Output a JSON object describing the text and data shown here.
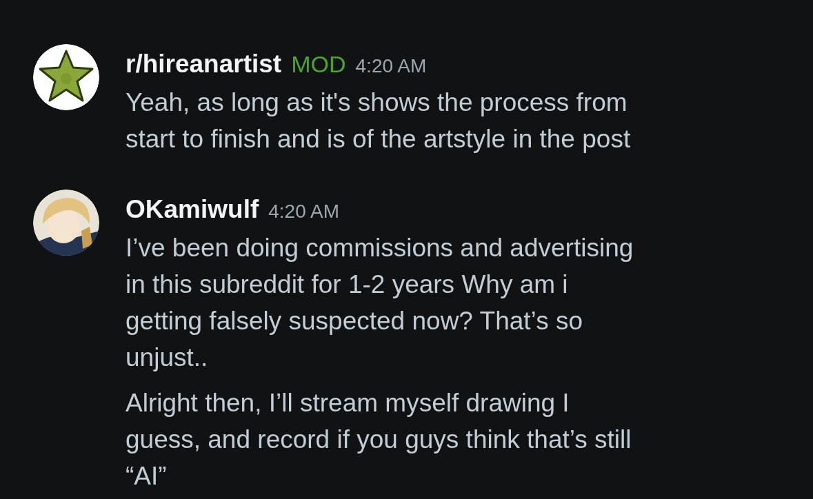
{
  "messages": [
    {
      "author": "r/hireanartist",
      "badge": "MOD",
      "time": "4:20 AM",
      "avatar": {
        "kind": "star"
      },
      "paragraphs": [
        "Yeah, as long as it's shows the process from\nstart to finish and is of the artstyle in the post"
      ]
    },
    {
      "author": "OKamiwulf",
      "time": "4:20 AM",
      "avatar": {
        "kind": "person"
      },
      "paragraphs": [
        "I’ve been doing commissions and advertising\nin this subreddit for 1-2 years Why am i\ngetting falsely suspected now? That’s so\nunjust..",
        "Alright then, I’ll stream myself drawing I\nguess, and record if you guys think that’s still\n“AI”"
      ]
    }
  ]
}
